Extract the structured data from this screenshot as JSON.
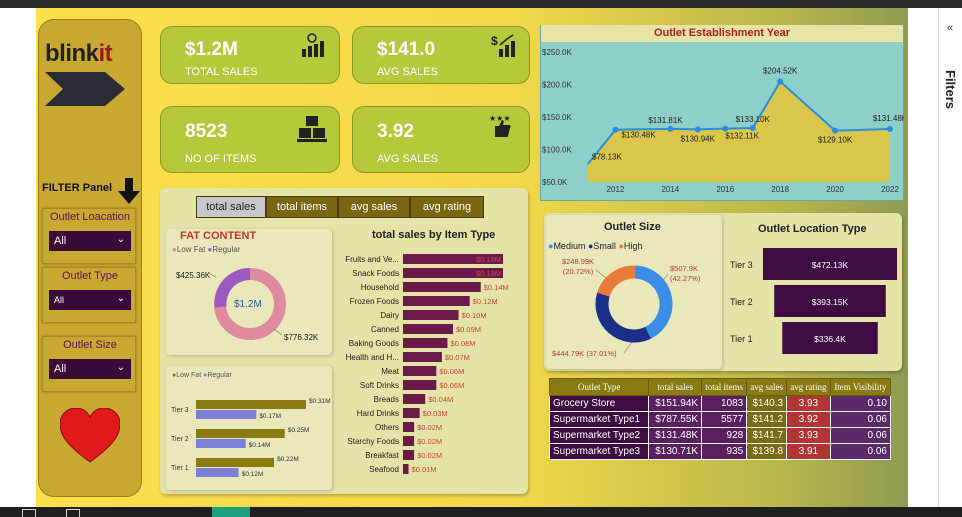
{
  "app": {
    "filters_label": "Filters",
    "collapse_icon": "double-chevron-left-icon"
  },
  "logo": {
    "text_main": "blink",
    "text_accent": "it"
  },
  "filter_panel": {
    "title": "FILTER Panel",
    "slicers": [
      {
        "title": "Outlet Loacation",
        "value": "All"
      },
      {
        "title": "Outlet Type",
        "value": "All"
      },
      {
        "title": "Outlet Size",
        "value": "All"
      }
    ]
  },
  "kpis": [
    {
      "value": "$1.2M",
      "label": "TOTAL SALES",
      "icon": "money-chart-icon"
    },
    {
      "value": "$141.0",
      "label": "AVG SALES",
      "icon": "dollar-growth-icon"
    },
    {
      "value": "8523",
      "label": "NO OF ITEMS",
      "icon": "boxes-icon"
    },
    {
      "value": "3.92",
      "label": "AVG SALES",
      "icon": "thumbs-stars-icon"
    }
  ],
  "tabs": [
    {
      "label": "total sales",
      "active": true
    },
    {
      "label": "total items",
      "active": false
    },
    {
      "label": "avg sales",
      "active": false
    },
    {
      "label": "avg rating",
      "active": false
    }
  ],
  "fat_content": {
    "title": "FAT CONTENT",
    "legend": [
      "Low Fat",
      "Regular"
    ],
    "center": "$1.2M",
    "labels": {
      "regular": "$425.36K",
      "low_fat": "$776.32K"
    },
    "colors": {
      "low_fat": "#e08aa0",
      "regular": "#9a5bc0"
    }
  },
  "fat_by_tier": {
    "legend": [
      "Low Fat",
      "Regular"
    ],
    "tiers": [
      {
        "tier": "Tier 3",
        "low_fat": "$0.31M",
        "regular": "$0.17M"
      },
      {
        "tier": "Tier 2",
        "low_fat": "$0.25M",
        "regular": "$0.14M"
      },
      {
        "tier": "Tier 1",
        "low_fat": "$0.22M",
        "regular": "$0.12M"
      }
    ]
  },
  "chart_data": [
    {
      "type": "bar",
      "title": "total sales by Item Type",
      "categories": [
        "Fruits and Ve...",
        "Snack Foods",
        "Household",
        "Frozen Foods",
        "Dairy",
        "Canned",
        "Baking Goods",
        "Health and H...",
        "Meat",
        "Soft Drinks",
        "Breads",
        "Hard Drinks",
        "Others",
        "Starchy Foods",
        "Breakfast",
        "Seafood"
      ],
      "values": [
        0.18,
        0.18,
        0.14,
        0.12,
        0.1,
        0.09,
        0.08,
        0.07,
        0.06,
        0.06,
        0.04,
        0.03,
        0.02,
        0.02,
        0.02,
        0.01
      ],
      "labels": [
        "$0.18M",
        "$0.18M",
        "$0.14M",
        "$0.12M",
        "$0.10M",
        "$0.09M",
        "$0.08M",
        "$0.07M",
        "$0.06M",
        "$0.06M",
        "$0.04M",
        "$0.03M",
        "$0.02M",
        "$0.02M",
        "$0.02M",
        "$0.01M"
      ]
    },
    {
      "type": "area",
      "title": "Outlet Establishment Year",
      "x": [
        2011,
        2012,
        2014,
        2015,
        2016,
        2017,
        2018,
        2020,
        2022
      ],
      "values": [
        78.13,
        130.48,
        131.81,
        130.94,
        132.11,
        133.1,
        204.52,
        129.1,
        131.48
      ],
      "labels": [
        "$78.13K",
        "$130.48K",
        "$131.81K",
        "$130.94K",
        "$132.11K",
        "$133.10K",
        "$204.52K",
        "$129.10K",
        "$131.48K"
      ],
      "xticks": [
        "2012",
        "2014",
        "2016",
        "2018",
        "2020",
        "2022"
      ],
      "yticks": [
        "$250.0K",
        "$200.0K",
        "$150.0K",
        "$100.0K",
        "$50.0K"
      ],
      "ylim": [
        50,
        250
      ]
    },
    {
      "type": "pie",
      "title": "Outlet Size",
      "legend": [
        "Medium",
        "Small",
        "High"
      ],
      "values": [
        507.9,
        444.79,
        248.99
      ],
      "labels": [
        "$507.9K (42.27%)",
        "$444.79K (37.01%)",
        "$248.99K (20.72%)"
      ],
      "colors": [
        "#3a8ee8",
        "#1a2e8a",
        "#e87a3a"
      ]
    },
    {
      "type": "bar",
      "title": "Outlet Location Type",
      "categories": [
        "Tier 3",
        "Tier 2",
        "Tier 1"
      ],
      "values": [
        472.13,
        393.15,
        336.4
      ],
      "labels": [
        "$472.13K",
        "$393.15K",
        "$336.4K"
      ]
    }
  ],
  "outlet_table": {
    "headers": [
      "Outlet Type",
      "total sales",
      "total items",
      "avg sales",
      "avg rating",
      "Item Visibility"
    ],
    "rows": [
      [
        "Grocery Store",
        "$151.94K",
        "1083",
        "$140.3",
        "3.93",
        "0.10"
      ],
      [
        "Supermarket Type1",
        "$787.55K",
        "5577",
        "$141.2",
        "3.92",
        "0.06"
      ],
      [
        "Supermarket Type2",
        "$131.48K",
        "928",
        "$141.7",
        "3.93",
        "0.06"
      ],
      [
        "Supermarket Type3",
        "$130.71K",
        "935",
        "$139.8",
        "3.91",
        "0.06"
      ]
    ]
  }
}
